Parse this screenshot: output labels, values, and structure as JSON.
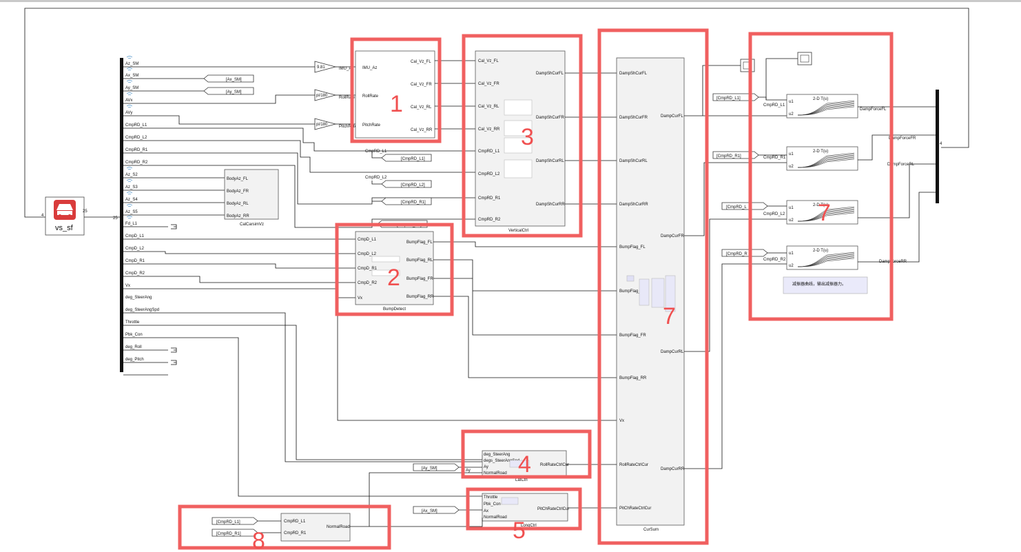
{
  "mux_signals": [
    "Az_SM",
    "Ax_SM",
    "Ay_SM",
    "AVx",
    "AVy",
    "CmpRD_L1",
    "CmpRD_L2",
    "CmpRD_R1",
    "CmpRD_R2",
    "Az_S2",
    "Az_S3",
    "Az_S4",
    "Az_S5",
    "Fd_L1",
    "CmpD_L1",
    "CmpD_L2",
    "CmpD_R1",
    "CmpD_R2",
    "Vx",
    "deg_SteerAng",
    "deg_SteerAngSpd",
    "Throttle",
    "Pbk_Con",
    "deg_Roll",
    "deg_Pitch"
  ],
  "mux_port_num": "25",
  "source_block": {
    "name": "vs_sf",
    "port_in": "4",
    "port_out": "25"
  },
  "gains": [
    "9.81",
    "pi/180",
    "pi/180"
  ],
  "goto_tags": {
    "ax": "[Ax_SM]",
    "ay": "[Ay_SM]",
    "cmp_l1": "[CmpRD_L1]",
    "cmp_l2": "[CmpRD_L2]",
    "cmp_r1": "[CmpRD_R1]",
    "cmp_r2": "[CmpRD_R2]",
    "cmp_l": "[CmpRD_L",
    "cmp_r": "[CmpRD_R"
  },
  "signal_labels": {
    "imu_az": "IMU_Az",
    "rollrate": "RollRate",
    "pitchrate": "PitchRate",
    "cmprd_l1": "CmpRD_L1",
    "cmprd_l2": "CmpRD_L2",
    "cmprd_r1": "CmpRD_R1",
    "cmprd_r2": "CmpRD_R2",
    "ay": "Ay"
  },
  "block1": {
    "inputs": [
      "IMU_Az",
      "RollRate",
      "PitchRate"
    ],
    "outputs": [
      "Cal_Vz_FL",
      "Cal_Vz_FR",
      "Cal_Vz_RL",
      "Cal_Vz_RR"
    ]
  },
  "calcarsim": {
    "name": "CalCarsimVz",
    "outputs": [
      "BodyAz_FL",
      "BodyAz_FR",
      "BodyAz_RL",
      "BodyAz_RR"
    ]
  },
  "vertical": {
    "name": "VerticalCtrl",
    "inputs": [
      "Cal_Vz_FL",
      "Cal_Vz_FR",
      "Cal_Vz_RL",
      "Cal_Vz_RR",
      "CmpRD_L1",
      "CmpRD_L2",
      "CmpRD_R1",
      "CmpRD_R2"
    ],
    "outputs": [
      "DampShCurFL",
      "DampShCurFR",
      "DampShCurRL",
      "DampShCurRR"
    ]
  },
  "bump": {
    "name": "BumpDetect",
    "inputs": [
      "CmpD_L1",
      "CmpD_L2",
      "CmpD_R1",
      "CmpD_R2",
      "Vx"
    ],
    "outputs": [
      "BumpFlag_FL",
      "BumpFlag_RL",
      "BumpFlag_FR",
      "BumpFlag_RR"
    ]
  },
  "cursum": {
    "name": "CurSum",
    "inputs": [
      "DampShCurFL",
      "DampShCurFR",
      "DampShCurRL",
      "DampShCurRR",
      "BumpFlag_FL",
      "BumpFlag_RL",
      "BumpFlag_FR",
      "BumpFlag_RR",
      "Vx",
      "RollRateCtrlCur",
      "PitChRateCtrlCur"
    ],
    "outputs": [
      "DampCurFL",
      "DampCurFR",
      "DampCurRL",
      "DampCurRR"
    ]
  },
  "latctrl": {
    "name": "LatCtrl",
    "inputs": [
      "deg_SteerAng",
      "degs_SteerAngSpd",
      "Ay",
      "NormalRoad"
    ],
    "output": "RollRateCtrlCur"
  },
  "longctrl": {
    "name": "LongCtrl",
    "inputs": [
      "Throttle",
      "Pbk_Con",
      "Ax",
      "NormalRoad"
    ],
    "output": "PitChRateCtrlCur"
  },
  "normalroad": {
    "inputs": [
      "CmpRD_L1",
      "CmpRD_R1"
    ],
    "output": "NormalRoad"
  },
  "lookup": {
    "title": "2-D T(u)",
    "u1": "u1",
    "u2": "u2",
    "outputs": [
      "DampForceFL",
      "DampForceFR",
      "DampForceRL",
      "DampForceRR"
    ],
    "note": "减振器曲线，输出减振器力。"
  },
  "out_mux_num": "4",
  "highlight_numbers": [
    "1",
    "2",
    "3",
    "4",
    "5",
    "7",
    "7",
    "8"
  ]
}
